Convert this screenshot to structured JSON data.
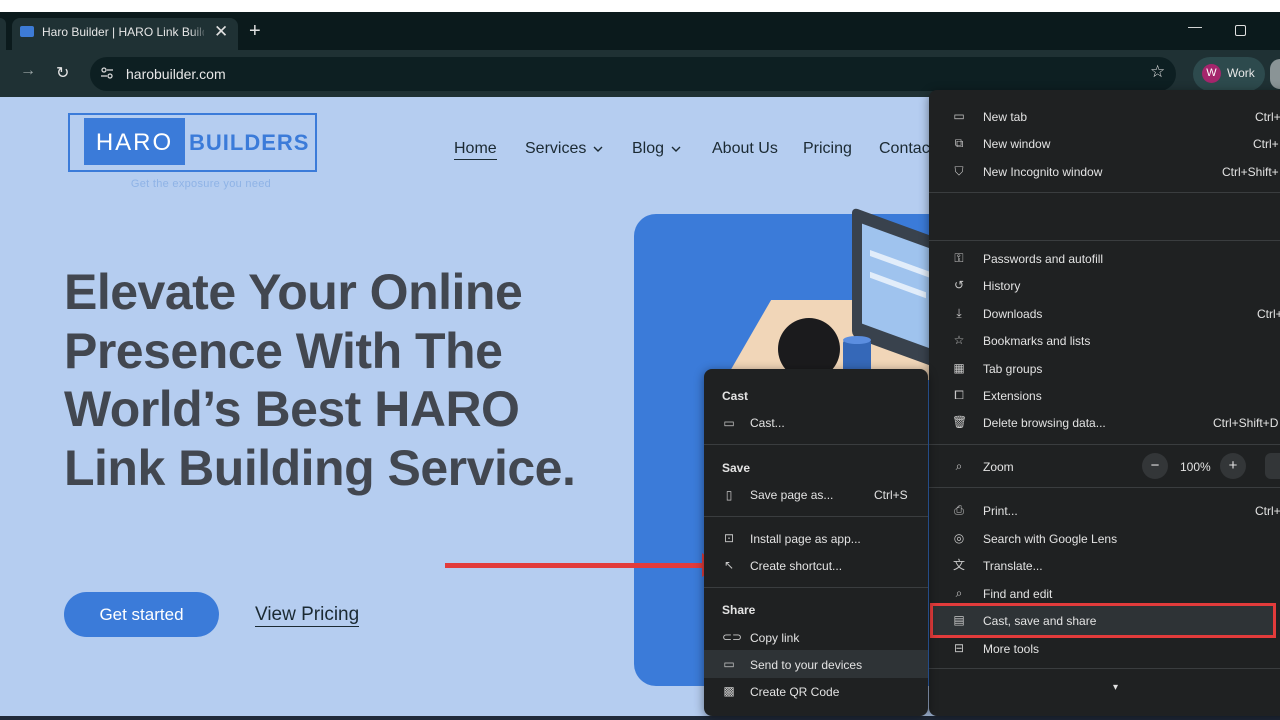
{
  "browser": {
    "tab_title": "Haro Builder | HARO Link Building Service",
    "url": "harobuilder.com",
    "profile_initial": "W",
    "profile_label": "Work",
    "new_tab_glyph": "+",
    "close_glyph": "✕",
    "minimize_glyph": "—"
  },
  "site": {
    "logo_haro": "HARO",
    "logo_builders": "BUILDERS",
    "tagline": "Get the exposure you need",
    "nav": [
      "Home",
      "Services",
      "Blog",
      "About Us",
      "Pricing",
      "Contac"
    ],
    "hero_title": "Elevate Your Online Presence With The World’s Best HARO Link Building Service.",
    "cta_primary": "Get started",
    "cta_secondary": "View Pricing"
  },
  "main_menu": {
    "items": [
      {
        "label": "New tab",
        "shortcut": "Ctrl+",
        "icon": "new-tab-icon"
      },
      {
        "label": "New window",
        "shortcut": "Ctrl+",
        "icon": "new-window-icon"
      },
      {
        "label": "New Incognito window",
        "shortcut": "Ctrl+Shift+",
        "icon": "incognito-icon"
      },
      {
        "label": "Passwords and autofill",
        "shortcut": "",
        "icon": "key-icon"
      },
      {
        "label": "History",
        "shortcut": "",
        "icon": "history-icon"
      },
      {
        "label": "Downloads",
        "shortcut": "Ctrl+",
        "icon": "download-icon"
      },
      {
        "label": "Bookmarks and lists",
        "shortcut": "",
        "icon": "star-icon"
      },
      {
        "label": "Tab groups",
        "shortcut": "",
        "icon": "tab-groups-icon"
      },
      {
        "label": "Extensions",
        "shortcut": "",
        "icon": "puzzle-icon"
      },
      {
        "label": "Delete browsing data...",
        "shortcut": "Ctrl+Shift+D",
        "icon": "trash-icon"
      },
      {
        "label": "Print...",
        "shortcut": "Ctrl+",
        "icon": "print-icon"
      },
      {
        "label": "Search with Google Lens",
        "shortcut": "",
        "icon": "lens-icon"
      },
      {
        "label": "Translate...",
        "shortcut": "",
        "icon": "translate-icon"
      },
      {
        "label": "Find and edit",
        "shortcut": "",
        "icon": "find-icon"
      },
      {
        "label": "Cast, save and share",
        "shortcut": "",
        "icon": "cast-save-share-icon"
      },
      {
        "label": "More tools",
        "shortcut": "",
        "icon": "toolbox-icon"
      }
    ],
    "zoom_label": "Zoom",
    "zoom_value": "100%",
    "zoom_minus": "−",
    "zoom_plus": "+",
    "expand_glyph": "▾"
  },
  "sub_menu": {
    "cast_header": "Cast",
    "cast_item": "Cast...",
    "save_header": "Save",
    "save_page": "Save page as...",
    "save_shortcut": "Ctrl+S",
    "install_app": "Install page as app...",
    "create_shortcut": "Create shortcut...",
    "share_header": "Share",
    "copy_link": "Copy link",
    "send_devices": "Send to your devices",
    "qr_code": "Create QR Code"
  },
  "colors": {
    "accent": "#3b7bd9",
    "page_bg": "#b5cdf0",
    "menu_bg": "#1f2122",
    "highlight": "#e23b3b"
  }
}
